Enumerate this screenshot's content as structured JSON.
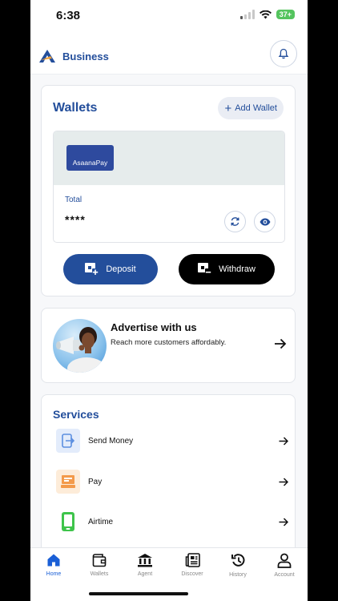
{
  "status_bar": {
    "time": "6:38",
    "battery": "37+"
  },
  "header": {
    "brand": "Business"
  },
  "wallets": {
    "title": "Wallets",
    "add_label": "Add Wallet",
    "card_brand": "AsaanaPay",
    "total_label": "Total",
    "total_value": "****",
    "deposit_label": "Deposit",
    "withdraw_label": "Withdraw"
  },
  "ad": {
    "title": "Advertise with us",
    "subtitle": "Reach more customers affordably."
  },
  "services": {
    "title": "Services",
    "items": [
      {
        "label": "Send Money",
        "icon": "send-money-icon"
      },
      {
        "label": "Pay",
        "icon": "pay-icon"
      },
      {
        "label": "Airtime",
        "icon": "airtime-icon"
      }
    ]
  },
  "tabbar": {
    "items": [
      {
        "label": "Home",
        "icon": "home-icon",
        "active": true
      },
      {
        "label": "Wallets",
        "icon": "wallet-icon",
        "active": false
      },
      {
        "label": "Agent",
        "icon": "bank-icon",
        "active": false
      },
      {
        "label": "Discover",
        "icon": "news-icon",
        "active": false
      },
      {
        "label": "History",
        "icon": "history-icon",
        "active": false
      },
      {
        "label": "Account",
        "icon": "person-icon",
        "active": false
      }
    ]
  },
  "colors": {
    "primary": "#234e9b",
    "active_tab": "#1a5fd6",
    "withdraw_bg": "#000000"
  }
}
